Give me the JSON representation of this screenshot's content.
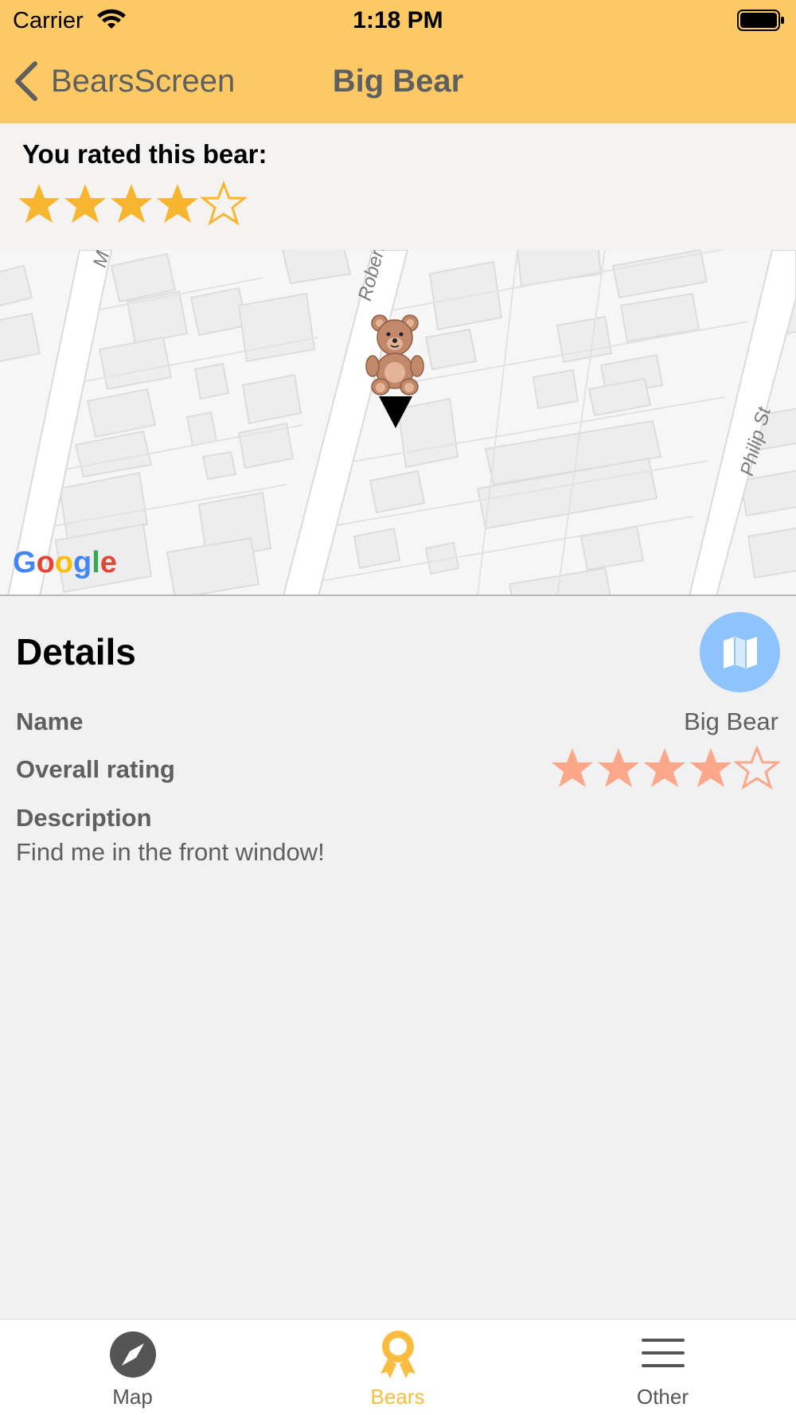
{
  "status_bar": {
    "carrier": "Carrier",
    "time": "1:18 PM"
  },
  "nav": {
    "back_label": "BearsScreen",
    "title": "Big Bear"
  },
  "user_rating": {
    "title": "You rated this bear:",
    "stars_filled": 4,
    "stars_total": 5,
    "color": "#f8b630"
  },
  "map": {
    "street_labels": [
      "Roberts St",
      "Philip St",
      "M"
    ],
    "logo_text": "Google",
    "marker_icon": "teddy-bear-icon"
  },
  "details": {
    "title": "Details",
    "map_button_icon": "map-icon",
    "name_label": "Name",
    "name_value": "Big Bear",
    "rating_label": "Overall rating",
    "overall_stars_filled": 4,
    "overall_stars_total": 5,
    "overall_star_color": "#fca68a",
    "description_label": "Description",
    "description_text": "Find me in the front window!"
  },
  "tabs": [
    {
      "label": "Map",
      "icon": "compass-icon",
      "active": false
    },
    {
      "label": "Bears",
      "icon": "award-ribbon-icon",
      "active": true
    },
    {
      "label": "Other",
      "icon": "menu-icon",
      "active": false
    }
  ],
  "colors": {
    "header": "#fcc964",
    "accent": "#f8bd3f",
    "fab": "#8ec3fb"
  }
}
